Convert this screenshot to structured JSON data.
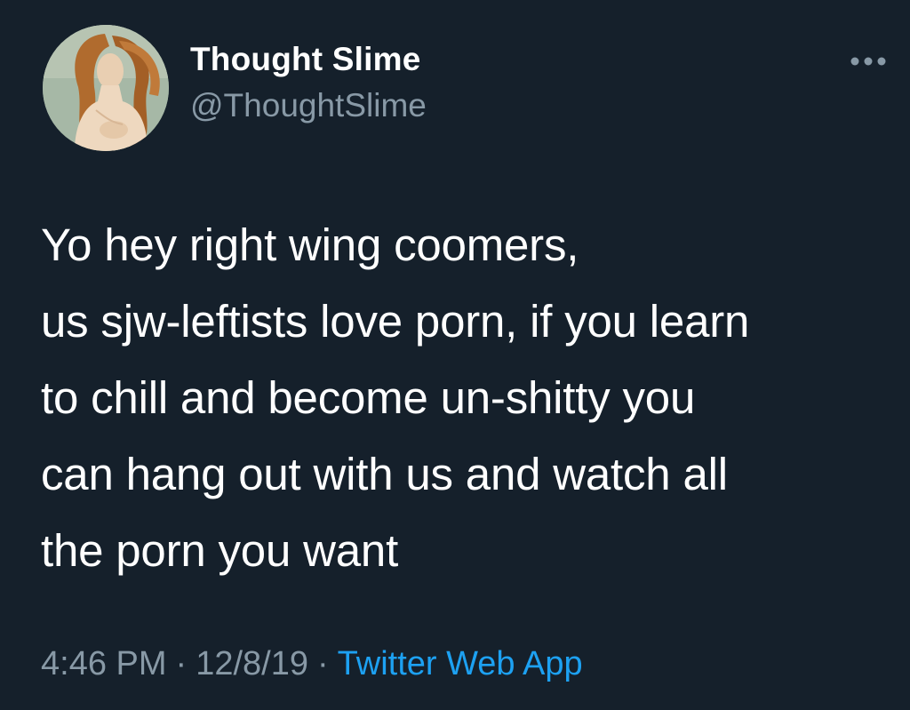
{
  "author": {
    "display_name": "Thought Slime",
    "handle": "@ThoughtSlime"
  },
  "tweet": {
    "text": "Yo hey right wing coomers,\nus sjw-leftists love porn, if you learn\nto chill and become un-shitty you\ncan hang out with us and watch all\nthe porn you want"
  },
  "meta": {
    "time": "4:46 PM",
    "date": "12/8/19",
    "separator": "·",
    "source": "Twitter Web App"
  },
  "icons": {
    "more": "more-horizontal-icon",
    "avatar": "avatar-image"
  },
  "colors": {
    "background": "#15202b",
    "text_primary": "#ffffff",
    "text_secondary": "#8899a6",
    "link": "#1da1f2"
  }
}
